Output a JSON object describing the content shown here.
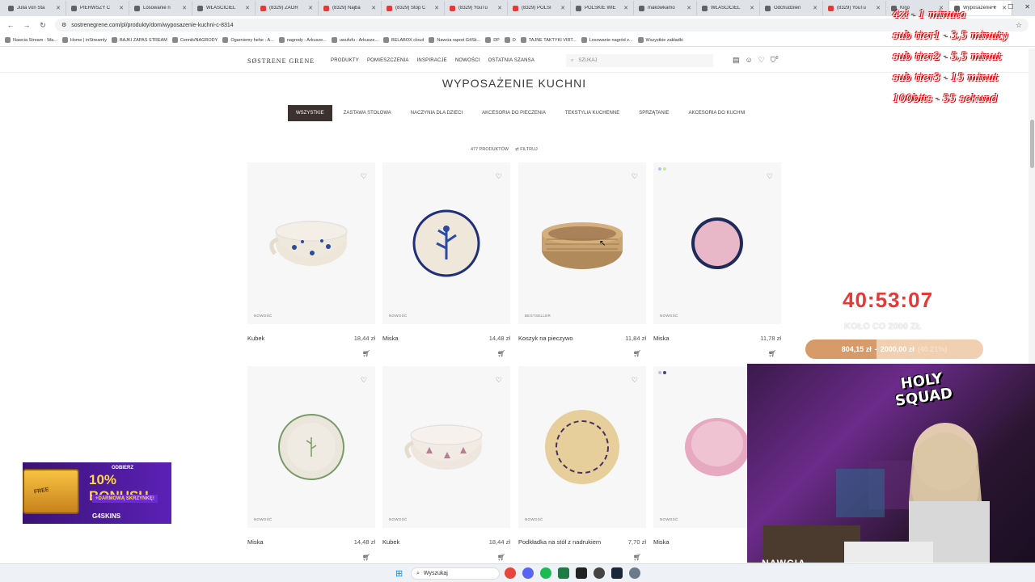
{
  "browser": {
    "tabs": [
      {
        "label": "Julia von Sta"
      },
      {
        "label": "PIERWSZY C"
      },
      {
        "label": "Losowanie n"
      },
      {
        "label": "WŁAŚCICIEL"
      },
      {
        "label": "(8329) ZAOR"
      },
      {
        "label": "(8329) Najba"
      },
      {
        "label": "(8329) Stop C"
      },
      {
        "label": "(8329) YouTu"
      },
      {
        "label": "(8329) POLSI"
      },
      {
        "label": "POLSKIE WIE"
      },
      {
        "label": "makowkamo"
      },
      {
        "label": "WŁAŚCICIEL"
      },
      {
        "label": "Odchudzilen"
      },
      {
        "label": "(8329) YouTu"
      },
      {
        "label": "Kino"
      },
      {
        "label": "Wyposażenie k"
      }
    ],
    "url": "sostrenegrene.com/pl/produkty/dom/wyposazenie-kuchni-c-8314",
    "bookmarks": [
      "Nawcia Stream - Wa...",
      "Home | inStreamly",
      "BAJKI ZAPAS STREAM",
      "Cennik/NAGRODY",
      "Ogarniemy hehe - A...",
      "nagrody - Arkusze...",
      "uwufufu - Arkusze...",
      "BELABOX cloud",
      "Nawcia raport G4Sk...",
      "DP",
      "D",
      "TAJNE TAKTYKI VIRT...",
      "Losowanie nagród z...",
      "Wszystkie zakładki"
    ]
  },
  "site": {
    "logo": "SØSTRENE GRENE",
    "nav": [
      "PRODUKTY",
      "POMIESZCZENIA",
      "INSPIRACJE",
      "NOWOŚCI",
      "OSTATNIA SZANSA"
    ],
    "search_placeholder": "SZUKAJ",
    "cart_count": "0"
  },
  "page": {
    "title": "WYPOSAŻENIE KUCHNI",
    "categories": [
      "WSZYSTKIE",
      "ZASTAWA STOŁOWA",
      "NACZYNIA DLA DZIECI",
      "AKCESORIA DO PIECZENIA",
      "TEKSTYLIA KUCHENNE",
      "SPRZĄTANIE",
      "AKCESORIA DO KUCHNI"
    ],
    "product_count": "477 PRODUKTÓW",
    "filter_label": "FILTRUJ"
  },
  "products": [
    {
      "name": "Kubek",
      "price": "18,44 zł",
      "badge": "NOWOŚĆ",
      "type": "mug-blue"
    },
    {
      "name": "Miska",
      "price": "14,48 zł",
      "badge": "NOWOŚĆ",
      "type": "plate-blue"
    },
    {
      "name": "Koszyk na pieczywo",
      "price": "11,84 zł",
      "badge": "BESTSELLER",
      "type": "basket"
    },
    {
      "name": "Miska",
      "price": "11,78 zł",
      "badge": "NOWOŚĆ",
      "type": "bowl-pink-navy"
    },
    {
      "name": "Miska",
      "price": "14,48 zł",
      "badge": "NOWOŚĆ",
      "type": "plate-green"
    },
    {
      "name": "Kubek",
      "price": "18,44 zł",
      "badge": "NOWOŚĆ",
      "type": "mug-pink"
    },
    {
      "name": "Podkładka na stół z nadrukiem",
      "price": "7,70 zł",
      "badge": "NOWOŚĆ",
      "type": "placemat"
    },
    {
      "name": "Miska",
      "price": "",
      "badge": "NOWOŚĆ",
      "type": "bowl-pink"
    }
  ],
  "overlay": {
    "donations": [
      "4zł - 1 minuta",
      "sub tier1 - 3,5 minuty",
      "sub tier2 - 5,5 minut",
      "sub tier3 - 15 minut",
      "100bits - 55 sekund"
    ],
    "timer": "40:53:07",
    "wheel": "KOŁO CO 2000 ZŁ",
    "goal_current": "804,15 zł",
    "goal_sep": "-",
    "goal_target": "2000,00 zł",
    "goal_percent": "(40.21%)",
    "goal_fraction": 0.4021,
    "squad": "HOLY SQUAD",
    "streamer": "NAWCIA",
    "ad": {
      "line1": "ODBIERZ",
      "line2": "10% BONUSU",
      "line3": "+DARMOWĄ SKRZYNKĘ!",
      "brand": "G4SKINS",
      "chest": "FREE"
    }
  },
  "taskbar": {
    "search": "Wyszukaj"
  },
  "colors": {
    "accent": "#3b322d",
    "timer": "#e53935",
    "goal_fill": "#d79b6a"
  }
}
